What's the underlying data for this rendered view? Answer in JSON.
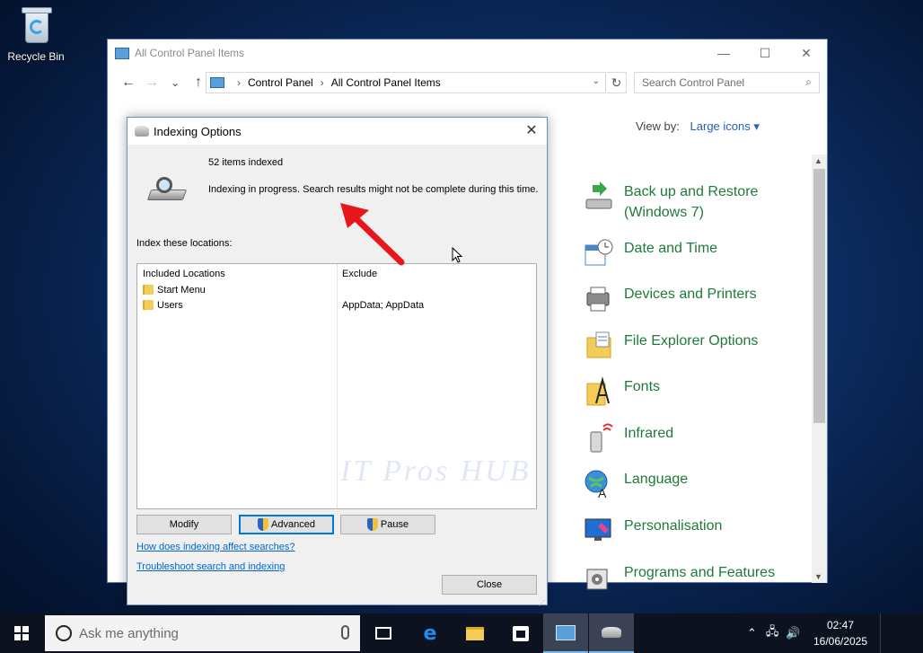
{
  "desktop": {
    "recycle_bin_label": "Recycle Bin"
  },
  "control_panel": {
    "title": "All Control Panel Items",
    "window_controls": [
      "—",
      "☐",
      "✕"
    ],
    "nav": {
      "back": "←",
      "forward": "→",
      "recent": "⌄",
      "up": "↑"
    },
    "breadcrumb": [
      "Control Panel",
      "All Control Panel Items"
    ],
    "search_placeholder": "Search Control Panel",
    "view_by_label": "View by:",
    "view_by_value": "Large icons ▾",
    "items": [
      {
        "label": "Back up and Restore\n(Windows 7)",
        "icon": "backup-restore-icon"
      },
      {
        "label": "Date and Time",
        "icon": "date-time-icon"
      },
      {
        "label": "Devices and Printers",
        "icon": "devices-printers-icon"
      },
      {
        "label": "File Explorer Options",
        "icon": "file-explorer-options-icon"
      },
      {
        "label": "Fonts",
        "icon": "fonts-icon"
      },
      {
        "label": "Infrared",
        "icon": "infrared-icon"
      },
      {
        "label": "Language",
        "icon": "language-icon"
      },
      {
        "label": "Personalisation",
        "icon": "personalisation-icon"
      },
      {
        "label": "Programs and Features",
        "icon": "programs-features-icon"
      }
    ]
  },
  "indexing_dialog": {
    "title": "Indexing Options",
    "close_glyph": "✕",
    "items_indexed": "52 items indexed",
    "status": "Indexing in progress. Search results might not be complete during this time.",
    "index_locations_label": "Index these locations:",
    "columns": [
      "Included Locations",
      "Exclude"
    ],
    "rows": [
      {
        "location": "Start Menu",
        "exclude": ""
      },
      {
        "location": "Users",
        "exclude": "AppData; AppData"
      }
    ],
    "watermark": "IT Pros HUB",
    "buttons": {
      "modify": "Modify",
      "advanced": "Advanced",
      "pause": "Pause",
      "close": "Close"
    },
    "links": {
      "how_indexing": "How does indexing affect searches?",
      "troubleshoot": "Troubleshoot search and indexing"
    }
  },
  "taskbar": {
    "search_placeholder": "Ask me anything",
    "time": "02:47",
    "date": "16/06/2025",
    "tray_icons": [
      "chevron-up-icon",
      "network-icon",
      "volume-icon"
    ]
  },
  "colors": {
    "link": "#0066cc",
    "cp_item_text": "#1e7a3a",
    "annotation_arrow": "#e8161b",
    "taskbar_bg": "#0c1220"
  }
}
